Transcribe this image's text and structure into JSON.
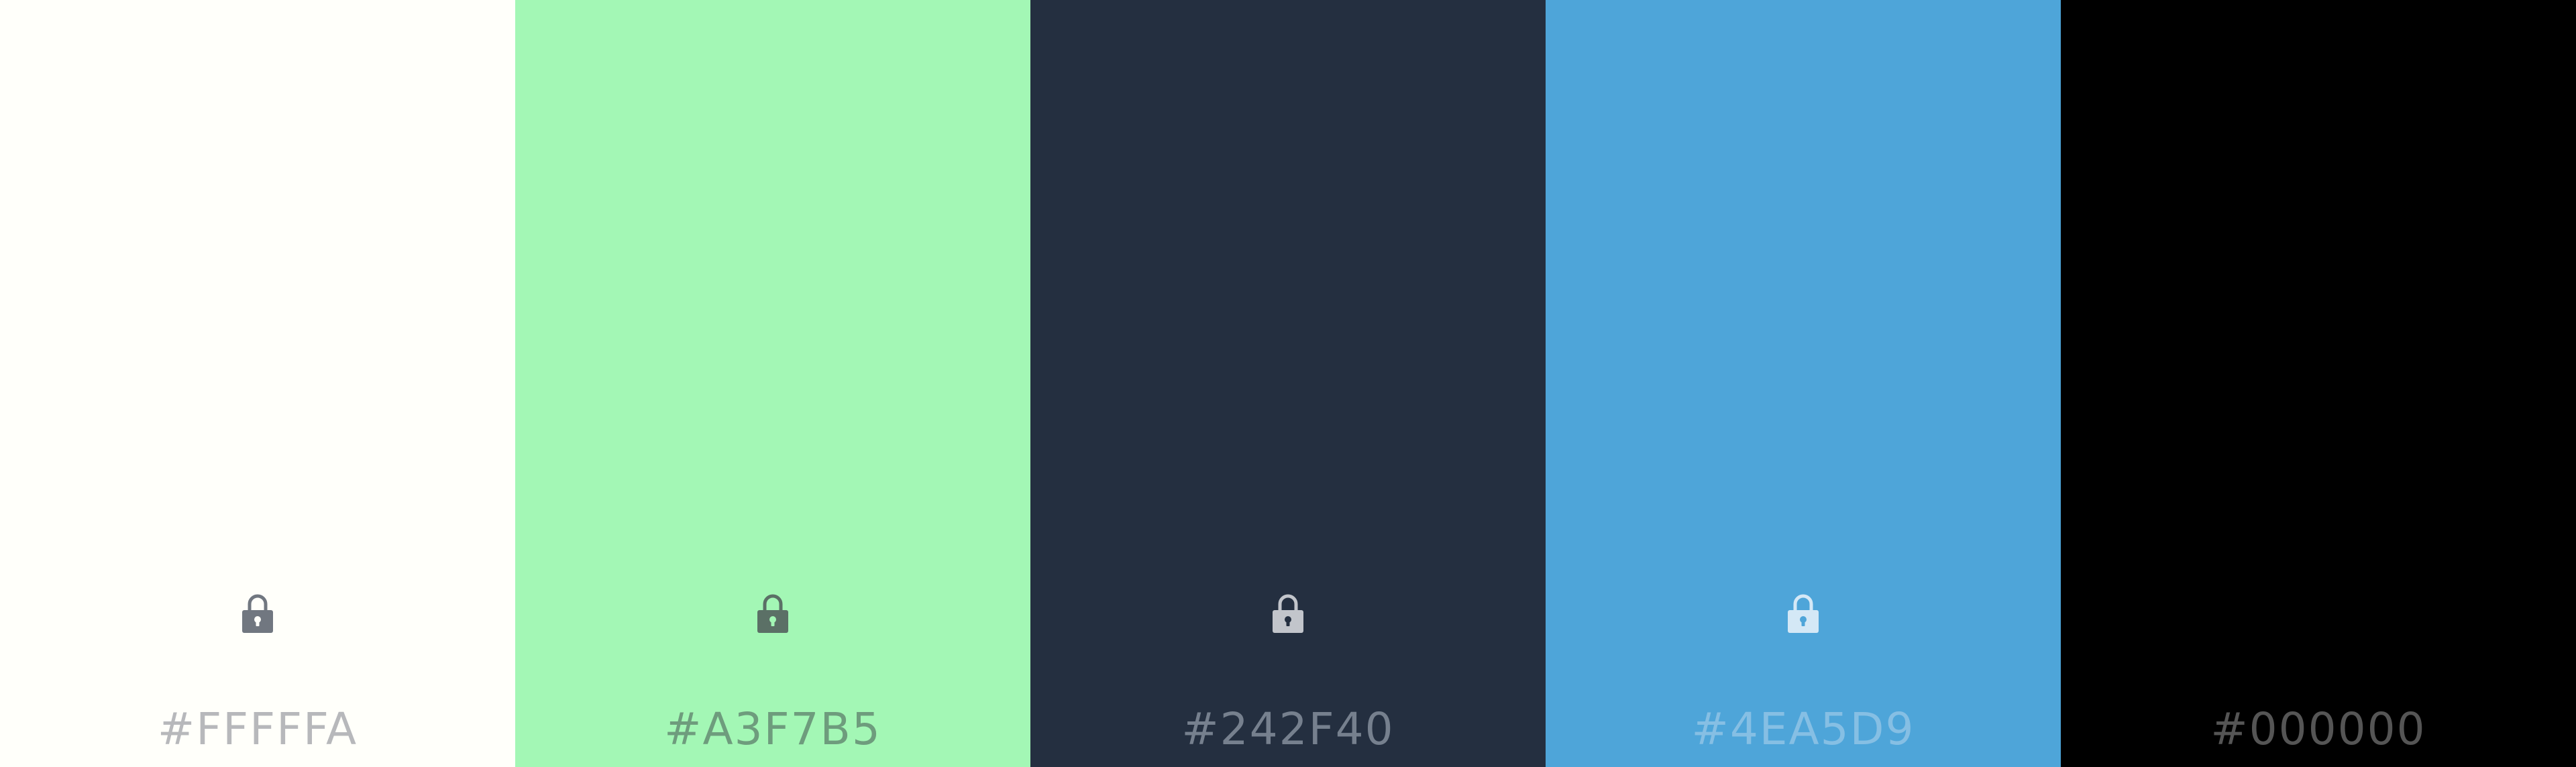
{
  "palette": {
    "swatches": [
      {
        "hex": "#FFFFFA",
        "background": "#FFFFFA",
        "label_color": "#B7B8BB",
        "lock_color": "#717780",
        "lock_hole_color": "#FFFFFA",
        "lock_icon": "lock-icon"
      },
      {
        "hex": "#A3F7B5",
        "background": "#A3F7B5",
        "label_color": "#6E9C7D",
        "lock_color": "#5B7066",
        "lock_hole_color": "#A3F7B5",
        "lock_icon": "lock-icon"
      },
      {
        "hex": "#242F40",
        "background": "#242F40",
        "label_color": "#76808E",
        "lock_color": "#C2C5CB",
        "lock_hole_color": "#242F40",
        "lock_icon": "lock-icon"
      },
      {
        "hex": "#4EA5D9",
        "background": "#4EA5D9",
        "label_color": "#86BFE4",
        "lock_color": "#D4E8F6",
        "lock_hole_color": "#4EA5D9",
        "lock_icon": "lock-icon"
      },
      {
        "hex": "#000000",
        "background": "#000000",
        "label_color": "#555555",
        "lock_color": null,
        "lock_hole_color": null,
        "lock_icon": null
      }
    ]
  }
}
